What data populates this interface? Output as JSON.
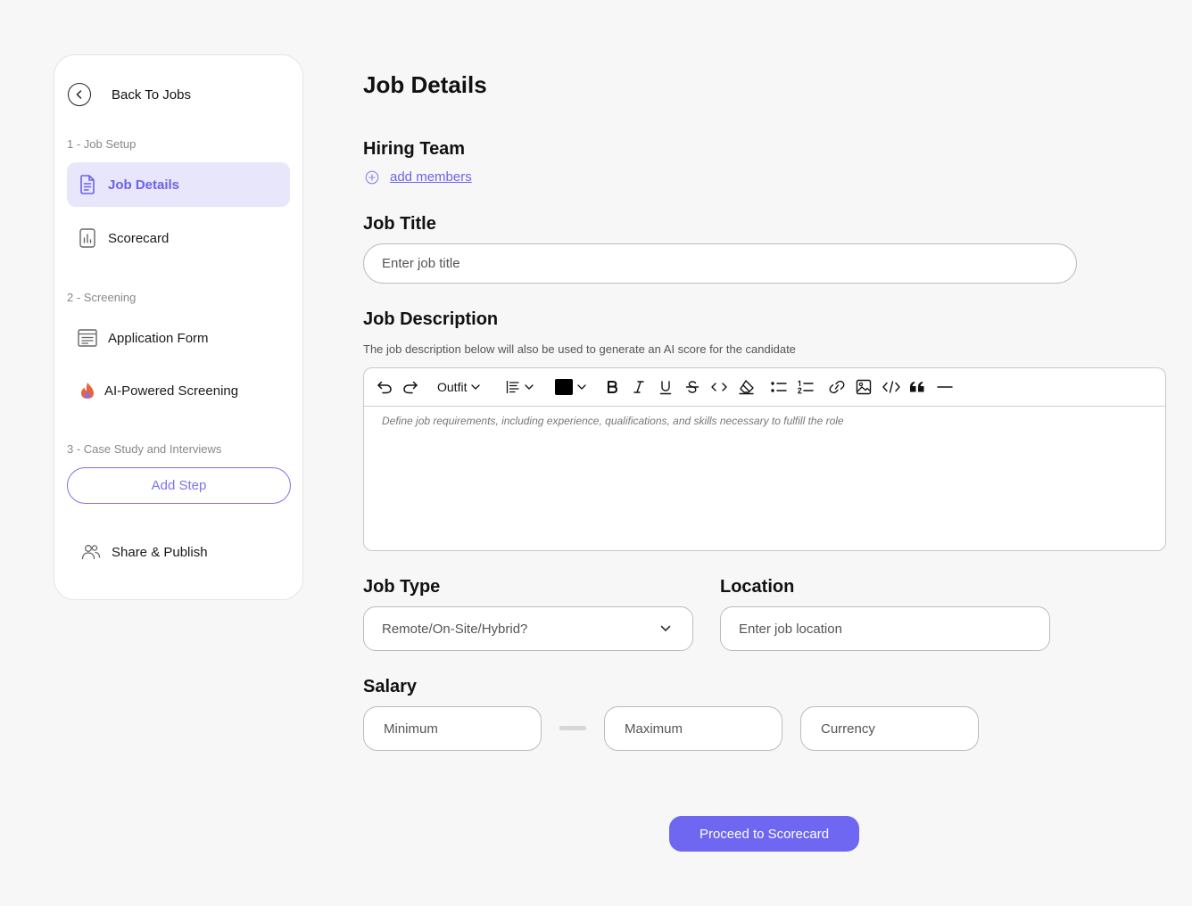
{
  "sidebar": {
    "back_label": "Back To Jobs",
    "sections": [
      {
        "label": "1 - Job Setup"
      },
      {
        "label": "2 - Screening"
      },
      {
        "label": "3 - Case Study and Interviews"
      }
    ],
    "items": [
      {
        "label": "Job Details",
        "icon": "document-icon",
        "active": true
      },
      {
        "label": "Scorecard",
        "icon": "bar-chart-icon"
      },
      {
        "label": "Application Form",
        "icon": "form-icon"
      },
      {
        "label": "AI-Powered Screening",
        "icon": "flame-icon"
      },
      {
        "label": "Share & Publish",
        "icon": "users-icon"
      }
    ],
    "add_step_label": "Add Step"
  },
  "main": {
    "title": "Job Details",
    "hiring_team": {
      "heading": "Hiring Team",
      "add_label": "add members"
    },
    "job_title": {
      "heading": "Job Title",
      "placeholder": "Enter job title"
    },
    "job_description": {
      "heading": "Job Description",
      "hint": "The job description below will also be used to generate an AI score for the candidate",
      "font": "Outfit",
      "placeholder": "Define job requirements, including experience, qualifications, and skills necessary to fulfill the role"
    },
    "job_type": {
      "heading": "Job Type",
      "value": "Remote/On-Site/Hybrid?"
    },
    "location": {
      "heading": "Location",
      "placeholder": "Enter job location"
    },
    "salary": {
      "heading": "Salary",
      "min_placeholder": "Minimum",
      "max_placeholder": "Maximum",
      "currency_placeholder": "Currency"
    },
    "proceed_label": "Proceed to Scorecard"
  },
  "colors": {
    "accent": "#6f66f2",
    "active_bg": "#e7e6fb",
    "flame": "#e8643c"
  }
}
